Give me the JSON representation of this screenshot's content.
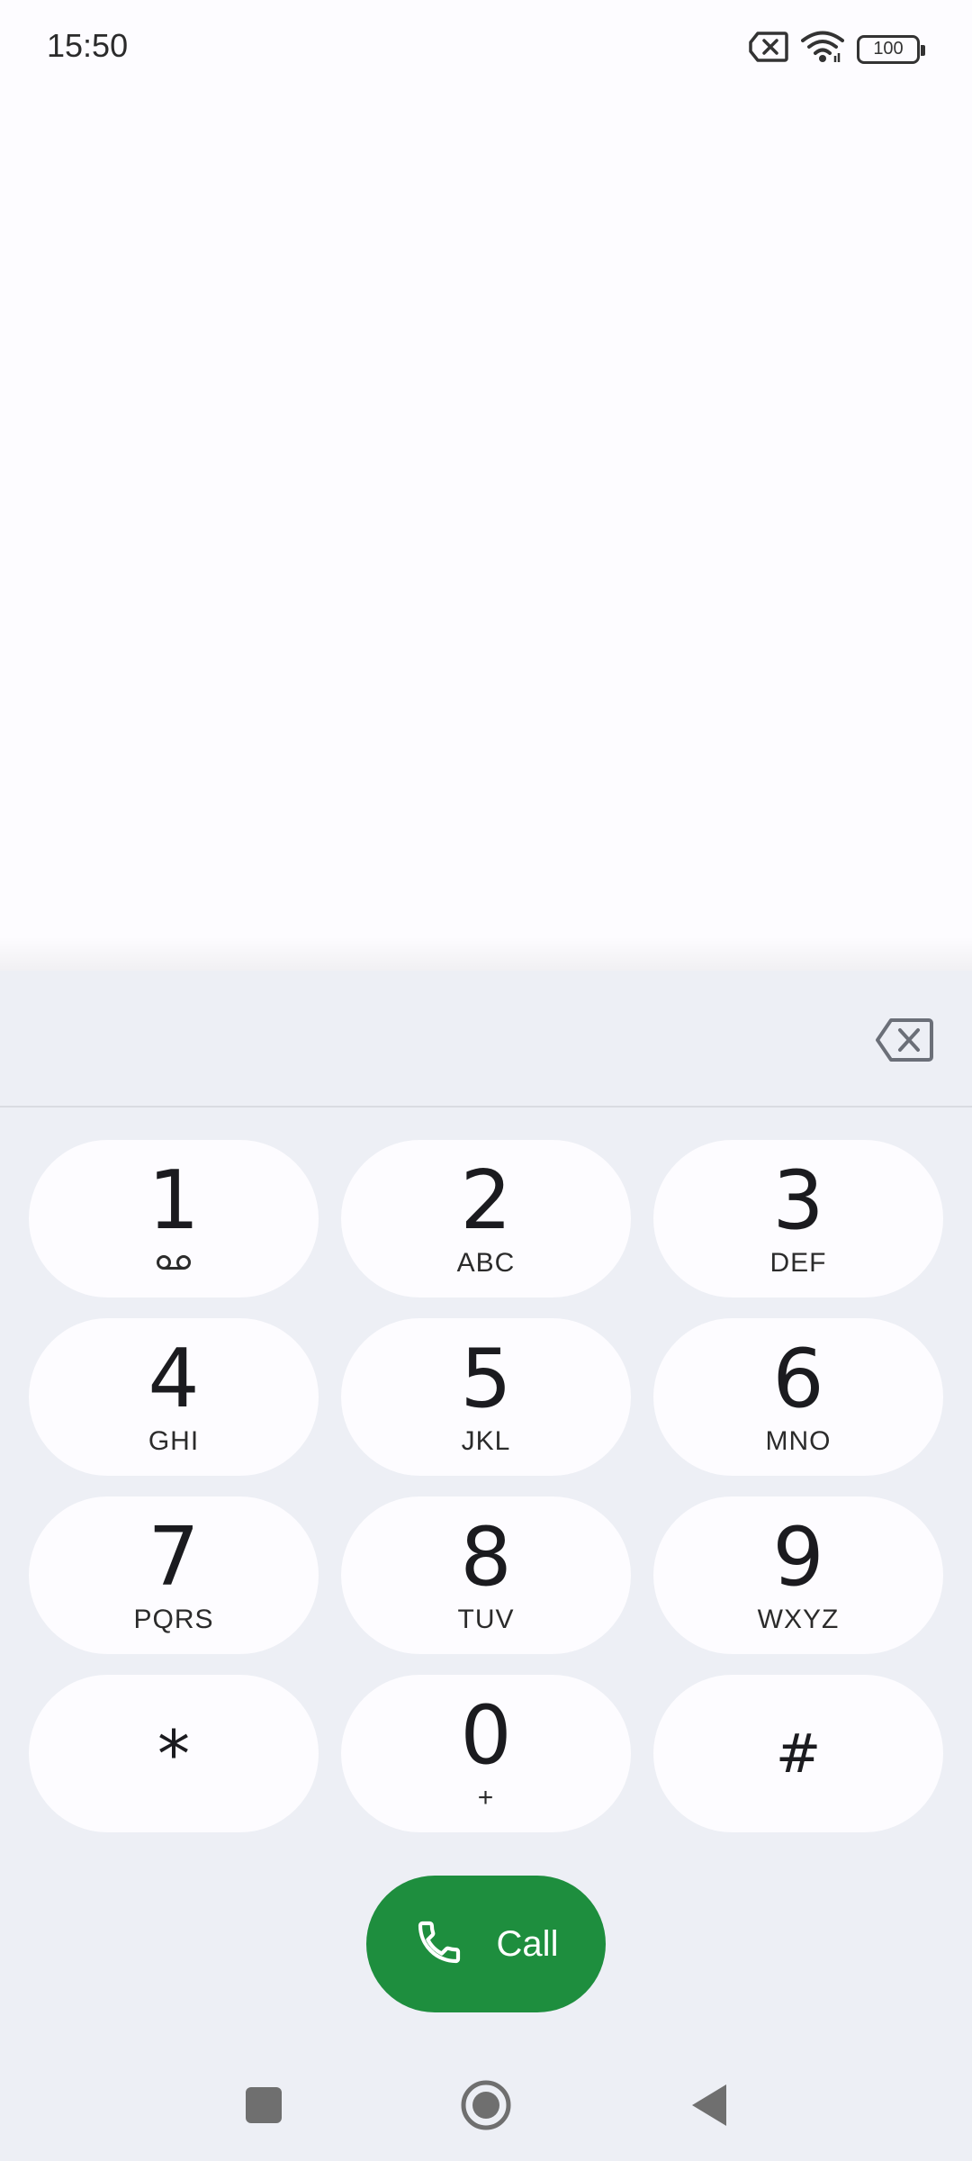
{
  "status_bar": {
    "time": "15:50",
    "icons": [
      "no-sim-icon",
      "wifi-icon",
      "battery-icon"
    ],
    "battery_level": "100"
  },
  "dialpad": {
    "digits_value": "",
    "backspace_icon": "backspace-icon",
    "keys": [
      {
        "digit": "1",
        "letters": "",
        "sub_icon": "voicemail-icon"
      },
      {
        "digit": "2",
        "letters": "ABC"
      },
      {
        "digit": "3",
        "letters": "DEF"
      },
      {
        "digit": "4",
        "letters": "GHI"
      },
      {
        "digit": "5",
        "letters": "JKL"
      },
      {
        "digit": "6",
        "letters": "MNO"
      },
      {
        "digit": "7",
        "letters": "PQRS"
      },
      {
        "digit": "8",
        "letters": "TUV"
      },
      {
        "digit": "9",
        "letters": "WXYZ"
      },
      {
        "digit": "*",
        "letters": ""
      },
      {
        "digit": "0",
        "letters": "+"
      },
      {
        "digit": "#",
        "letters": ""
      }
    ],
    "call_label": "Call",
    "call_icon": "phone-icon",
    "colors": {
      "call": "#1e8e3e",
      "sheet": "#edeff5",
      "key": "#fdfcff"
    }
  },
  "nav_bar": {
    "buttons": [
      "recents-icon",
      "home-icon",
      "back-icon"
    ]
  }
}
